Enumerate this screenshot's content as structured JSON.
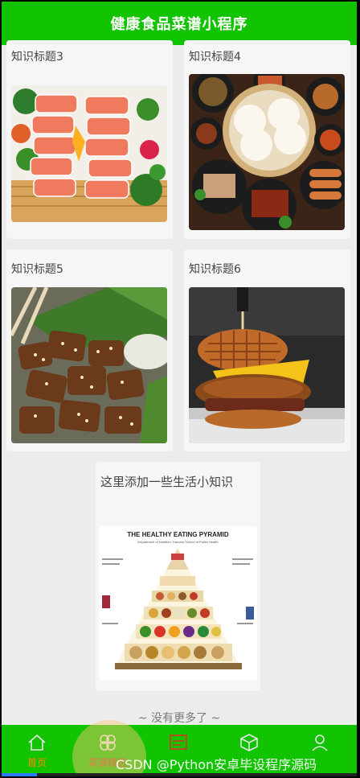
{
  "header": {
    "title": "健康食品菜谱小程序"
  },
  "cards": [
    {
      "title": "知识标题3",
      "image": "salmon-sashimi-platter"
    },
    {
      "title": "知识标题4",
      "image": "steamed-buns-dishes"
    },
    {
      "title": "知识标题5",
      "image": "grilled-eggplant-sesame"
    },
    {
      "title": "知识标题6",
      "image": "waffle-chicken-burger"
    }
  ],
  "feature_card": {
    "text": "这里添加一些生活小知识",
    "image_caption": "THE HEALTHY EATING PYRAMID",
    "image_subcaption": "Department of Nutrition, Harvard School of Public Health"
  },
  "list_end": "~ 没有更多了 ~",
  "tabbar": {
    "items": [
      {
        "label": "首页",
        "icon": "home-icon",
        "active": true
      },
      {
        "label": "菜谱精选",
        "icon": "clover-icon",
        "active": false
      },
      {
        "label": "",
        "icon": "board-icon",
        "active": false
      },
      {
        "label": "",
        "icon": "cube-icon",
        "active": false
      },
      {
        "label": "",
        "icon": "user-icon",
        "active": false
      }
    ]
  },
  "watermark": "CSDN @Python安卓毕设程序源码",
  "colors": {
    "primary": "#12c300",
    "active_tab": "#ff8a00",
    "inactive_tab": "#e7e7e7"
  },
  "loading_progress": 0.1
}
